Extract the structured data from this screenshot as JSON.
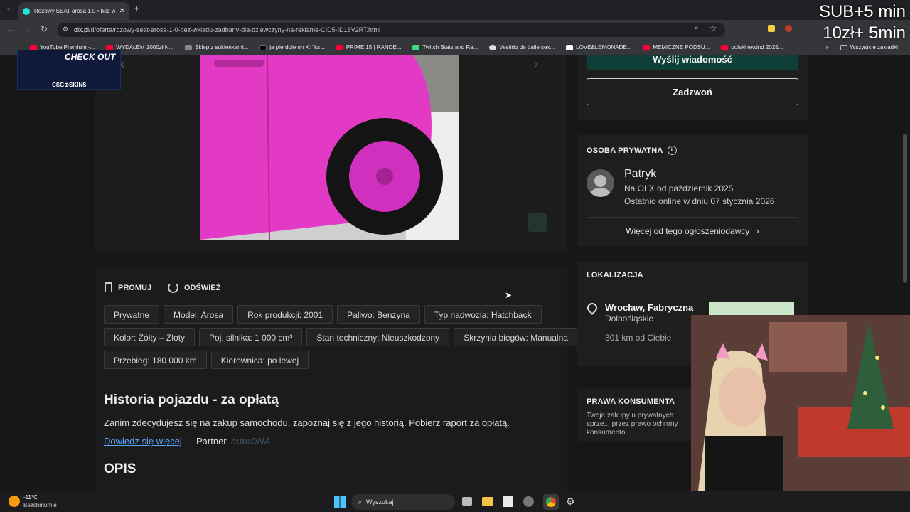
{
  "browser": {
    "tab_title": "Różowy SEAT arosa 1.0 • bez wkl",
    "url_domain": "olx.pl",
    "url_path": "/d/oferta/rozowy-seat-arosa-1-0-bez-wkladu-zadbany-dla-dziewczyny-na-reklame-CID5-ID18V2RT.html",
    "bookmarks": [
      "YouTube Premium -...",
      "WYDAŁEM 1000zł N...",
      "Sklep z sukienkami...",
      "ja pierdole on X: \"ks...",
      "PRIME 15 | RANDE...",
      "Twitch Stats and Ra...",
      "Vestido de baile sex...",
      "LOVE&LEMONADE...",
      "MEMICZNE PODSU...",
      "polski rewind 2025..."
    ],
    "all_bookmarks": "Wszystkie zakładki"
  },
  "overlay": {
    "sub_line1": "SUB+5 min",
    "sub_line2": "10zł+ 5min",
    "ad_title": "CHECK OUT",
    "ad_brand": "CSG⊕SKINS"
  },
  "listing": {
    "promote": "PROMUJ",
    "refresh": "ODŚWIEŻ",
    "tags_row1": [
      "Prywatne",
      "Model: Arosa",
      "Rok produkcji: 2001",
      "Paliwo: Benzyna",
      "Typ nadwozia: Hatchback"
    ],
    "tags_row2": [
      "Kolor: Żółty – Złoty",
      "Poj. silnika: 1 000 cm³",
      "Stan techniczny: Nieuszkodzony",
      "Skrzynia biegów: Manualna"
    ],
    "tags_row3": [
      "Przebieg: 180 000 km",
      "Kierownica: po lewej"
    ],
    "history_title": "Historia pojazdu - za opłatą",
    "history_text": "Zanim zdecydujesz się na zakup samochodu, zapoznaj się z jego historią. Pobierz raport za opłatą.",
    "learn_more": "Dowiedz się więcej",
    "partner": "Partner",
    "partner_brand": "autoDNA",
    "description_title": "OPIS"
  },
  "sidebar": {
    "send_message": "Wyślij wiadomość",
    "call": "Zadzwoń",
    "seller_type": "OSOBA PRYWATNA",
    "seller_name": "Patryk",
    "seller_since": "Na OLX od październik 2025",
    "seller_online": "Ostatnio online w dniu 07 stycznia 2026",
    "more_from_seller": "Więcej od tego ogłoszeniodawcy",
    "location_title": "LOKALIZACJA",
    "city": "Wrocław, Fabryczna",
    "region": "Dolnośląskie",
    "distance": "301 km od Ciebie",
    "consumer_title": "PRAWA KONSUMENTA",
    "consumer_text": "Twoje zakupy u prywatnych sprze... przez prawo ochrony konsumento..."
  },
  "taskbar": {
    "temp": "-11°C",
    "weather": "Bezchmurnie",
    "search": "Wyszukaj"
  },
  "colors": {
    "car_pink": "#e23ac4",
    "olx_teal": "#23e5db",
    "link_blue": "#5aa7ff"
  }
}
